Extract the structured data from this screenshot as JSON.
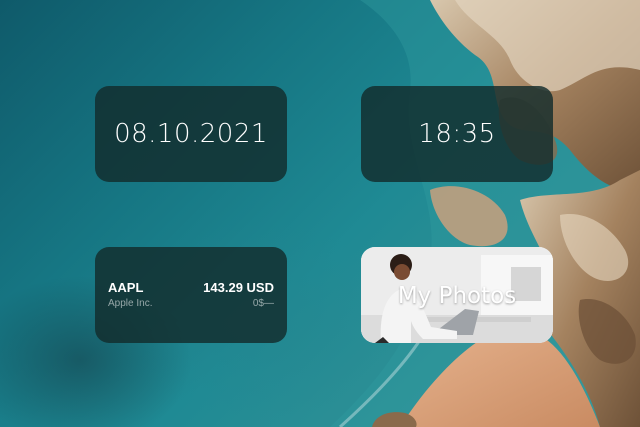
{
  "widgets": {
    "date": {
      "value": "08.10.2021"
    },
    "time": {
      "value": "18:35"
    },
    "stock": {
      "symbol": "AAPL",
      "company": "Apple Inc.",
      "price": "143.29 USD",
      "change": "0$—"
    },
    "photos": {
      "label": "My Photos"
    }
  },
  "colors": {
    "widget_background": "#122c2c",
    "sea": "#167683",
    "rock": "#b89a76",
    "sand": "#d9a37c"
  }
}
